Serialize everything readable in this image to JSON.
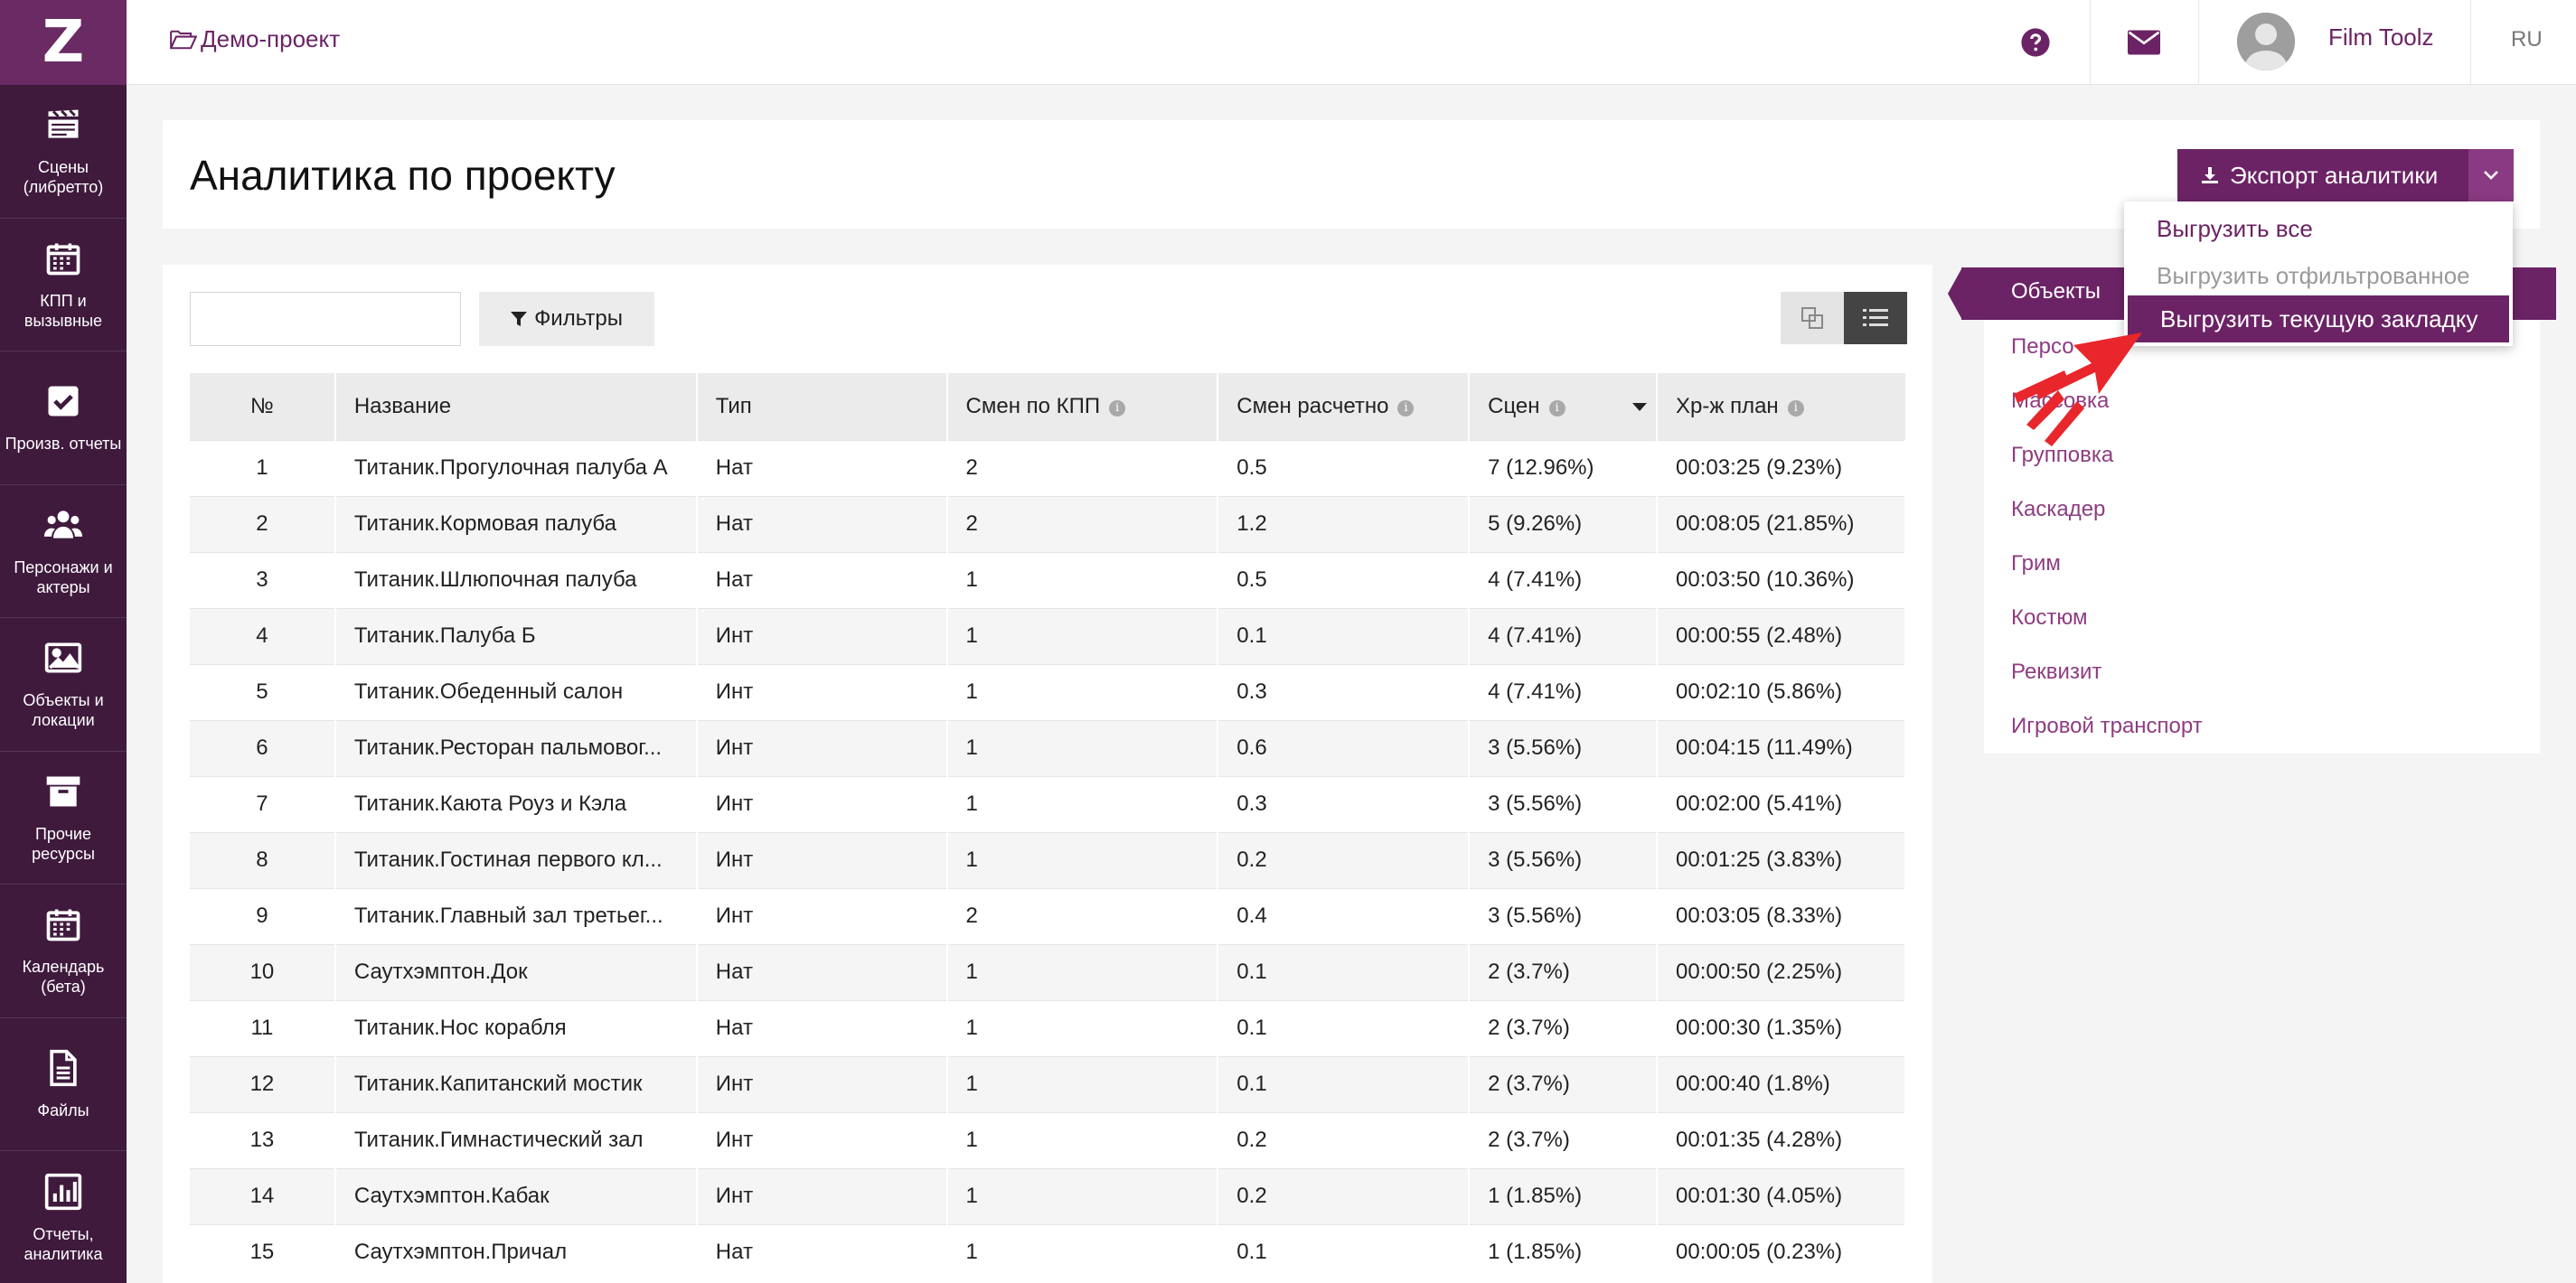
{
  "app": {
    "logo": "Z"
  },
  "sidebar": {
    "items": [
      {
        "label": "Сцены\n(либретто)",
        "icon": "clapperboard-icon"
      },
      {
        "label": "КПП и\nвызывные",
        "icon": "calendar-grid-icon"
      },
      {
        "label": "Произв. отчеты",
        "icon": "checkbox-icon"
      },
      {
        "label": "Персонажи и\nактеры",
        "icon": "people-icon"
      },
      {
        "label": "Объекты и\nлокации",
        "icon": "image-icon"
      },
      {
        "label": "Прочие\nресурсы",
        "icon": "archive-box-icon"
      },
      {
        "label": "Календарь\n(бета)",
        "icon": "calendar-icon"
      },
      {
        "label": "Файлы",
        "icon": "file-icon"
      },
      {
        "label": "Отчеты,\nаналитика",
        "icon": "bar-chart-icon"
      }
    ]
  },
  "topbar": {
    "project": "Демо-проект",
    "user_name": "Film Toolz",
    "language": "RU"
  },
  "header": {
    "title": "Аналитика по проекту",
    "export_label": "Экспорт аналитики"
  },
  "dropdown": {
    "items": [
      {
        "label": "Выгрузить все"
      },
      {
        "label": "Выгрузить отфильтрованное"
      },
      {
        "label": "Выгрузить текущую закладку"
      }
    ]
  },
  "toolbar": {
    "search_placeholder": "",
    "filters_label": "Фильтры"
  },
  "table": {
    "columns": [
      "№",
      "Название",
      "Тип",
      "Смен по КПП",
      "Смен расчетно",
      "Сцен",
      "Хр-ж план"
    ],
    "rows": [
      [
        "1",
        "Титаник.Прогулочная палуба А",
        "Нат",
        "2",
        "0.5",
        "7 (12.96%)",
        "00:03:25 (9.23%)"
      ],
      [
        "2",
        "Титаник.Кормовая палуба",
        "Нат",
        "2",
        "1.2",
        "5 (9.26%)",
        "00:08:05 (21.85%)"
      ],
      [
        "3",
        "Титаник.Шлюпочная палуба",
        "Нат",
        "1",
        "0.5",
        "4 (7.41%)",
        "00:03:50 (10.36%)"
      ],
      [
        "4",
        "Титаник.Палуба Б",
        "Инт",
        "1",
        "0.1",
        "4 (7.41%)",
        "00:00:55 (2.48%)"
      ],
      [
        "5",
        "Титаник.Обеденный салон",
        "Инт",
        "1",
        "0.3",
        "4 (7.41%)",
        "00:02:10 (5.86%)"
      ],
      [
        "6",
        "Титаник.Ресторан пальмовог...",
        "Инт",
        "1",
        "0.6",
        "3 (5.56%)",
        "00:04:15 (11.49%)"
      ],
      [
        "7",
        "Титаник.Каюта Роуз и Кэла",
        "Инт",
        "1",
        "0.3",
        "3 (5.56%)",
        "00:02:00 (5.41%)"
      ],
      [
        "8",
        "Титаник.Гостиная первого кл...",
        "Инт",
        "1",
        "0.2",
        "3 (5.56%)",
        "00:01:25 (3.83%)"
      ],
      [
        "9",
        "Титаник.Главный зал третьег...",
        "Инт",
        "2",
        "0.4",
        "3 (5.56%)",
        "00:03:05 (8.33%)"
      ],
      [
        "10",
        "Саутхэмптон.Док",
        "Нат",
        "1",
        "0.1",
        "2 (3.7%)",
        "00:00:50 (2.25%)"
      ],
      [
        "11",
        "Титаник.Нос корабля",
        "Нат",
        "1",
        "0.1",
        "2 (3.7%)",
        "00:00:30 (1.35%)"
      ],
      [
        "12",
        "Титаник.Капитанский мостик",
        "Инт",
        "1",
        "0.1",
        "2 (3.7%)",
        "00:00:40 (1.8%)"
      ],
      [
        "13",
        "Титаник.Гимнастический зал",
        "Инт",
        "1",
        "0.2",
        "2 (3.7%)",
        "00:01:35 (4.28%)"
      ],
      [
        "14",
        "Саутхэмптон.Кабак",
        "Инт",
        "1",
        "0.2",
        "1 (1.85%)",
        "00:01:30 (4.05%)"
      ],
      [
        "15",
        "Саутхэмптон.Причал",
        "Нат",
        "1",
        "0.1",
        "1 (1.85%)",
        "00:00:05 (0.23%)"
      ]
    ]
  },
  "tabs": {
    "active": "Объекты",
    "items": [
      "Персо",
      "Массовка",
      "Групповка",
      "Каскадер",
      "Грим",
      "Костюм",
      "Реквизит",
      "Игровой транспорт"
    ]
  },
  "colors": {
    "brand": "#6b2365",
    "sidebar": "#3f1a3d",
    "link": "#8e3c82",
    "pointer": "#e8262c"
  }
}
